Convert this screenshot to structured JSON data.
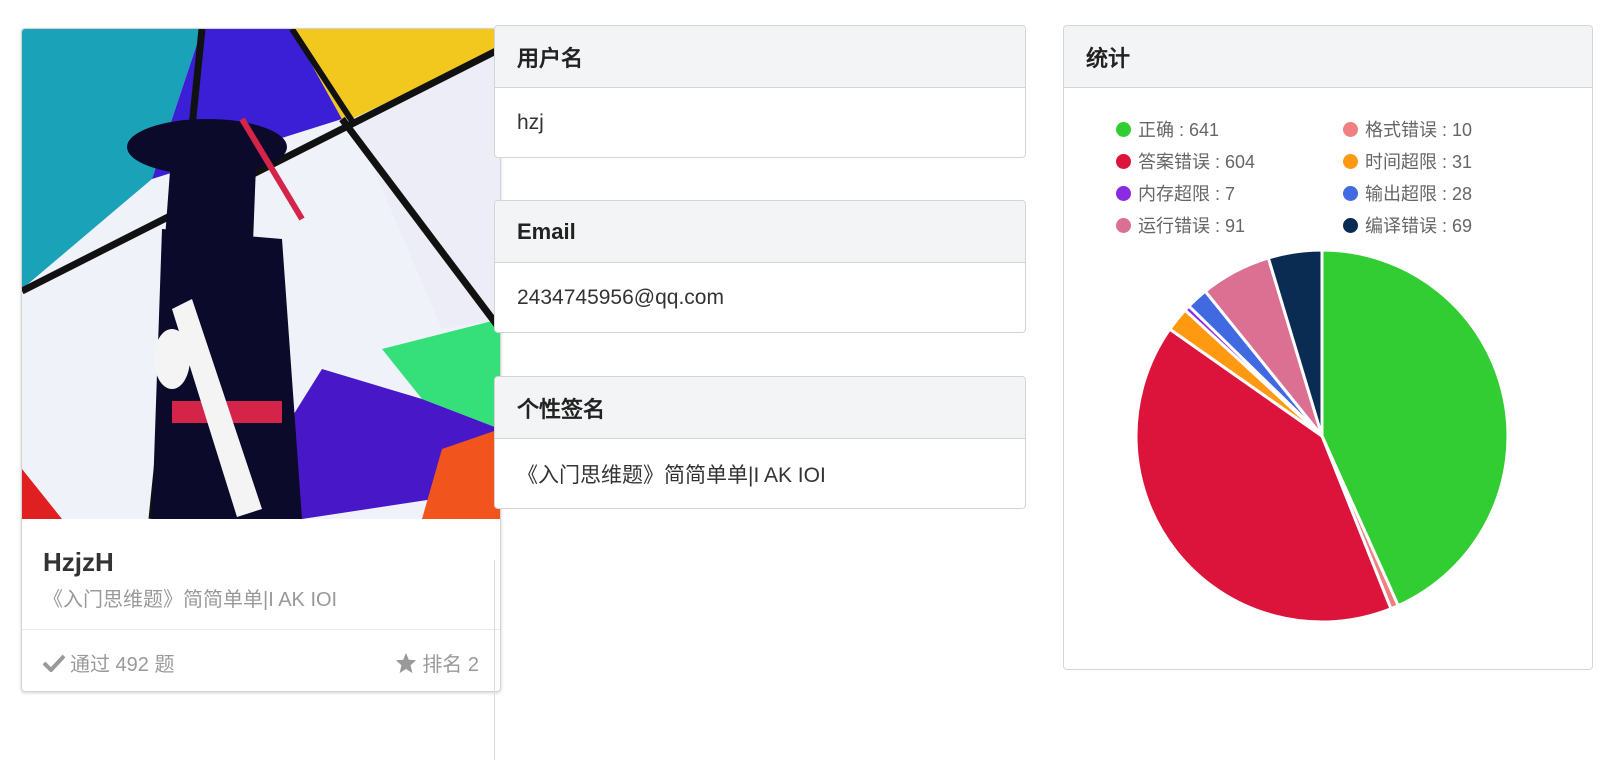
{
  "profile": {
    "name": "HzjzH",
    "signature": "《入门思维题》简简单单|I AK IOI",
    "accepted_label": "通过 492 题",
    "rank_label": "排名 2"
  },
  "username_section": {
    "title": "用户名",
    "value": "hzj"
  },
  "email_section": {
    "title": "Email",
    "value": "2434745956@qq.com"
  },
  "signature_section": {
    "title": "个性签名",
    "value": "《入门思维题》简简单单|I AK IOI"
  },
  "stats": {
    "title": "统计",
    "legend": [
      {
        "label": "正确 : 641",
        "color": "#32cd32"
      },
      {
        "label": "格式错误 : 10",
        "color": "#f08080"
      },
      {
        "label": "答案错误 : 604",
        "color": "#dc143c"
      },
      {
        "label": "时间超限 : 31",
        "color": "#ff9912"
      },
      {
        "label": "内存超限 : 7",
        "color": "#8a2be2"
      },
      {
        "label": "输出超限 : 28",
        "color": "#4169e1"
      },
      {
        "label": "运行错误 : 91",
        "color": "#db7093"
      },
      {
        "label": "编译错误 : 69",
        "color": "#0b2c52"
      }
    ]
  },
  "chart_data": {
    "type": "pie",
    "categories": [
      "正确",
      "格式错误",
      "答案错误",
      "时间超限",
      "内存超限",
      "输出超限",
      "运行错误",
      "编译错误"
    ],
    "values": [
      641,
      10,
      604,
      31,
      7,
      28,
      91,
      69
    ],
    "colors": [
      "#32cd32",
      "#f08080",
      "#dc143c",
      "#ff9912",
      "#8a2be2",
      "#4169e1",
      "#db7093",
      "#0b2c52"
    ],
    "title": "统计",
    "legend": "top"
  }
}
